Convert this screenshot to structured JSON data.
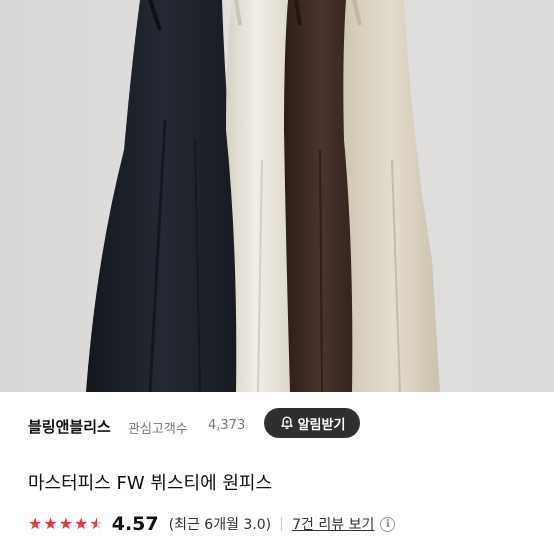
{
  "product_image": {
    "subject": "dresses-on-hangers",
    "colors": [
      "#1b1f27",
      "#e9e6dd",
      "#3b2a24",
      "#ddd4c4"
    ]
  },
  "seller": {
    "name": "블링앤블리스",
    "follower_label": "관심고객수",
    "follower_count": "4,373",
    "alert_button_label": "알림받기",
    "alert_icon": "bell-plus-icon"
  },
  "product": {
    "title": "마스터피스 FW 뷔스티에 원피스"
  },
  "rating": {
    "score": "4.57",
    "stars": 4.57,
    "period": "(최근 6개월 3.0)",
    "review_link": "7건 리뷰 보기",
    "info_icon": "i",
    "accent_color": "#e53935"
  }
}
